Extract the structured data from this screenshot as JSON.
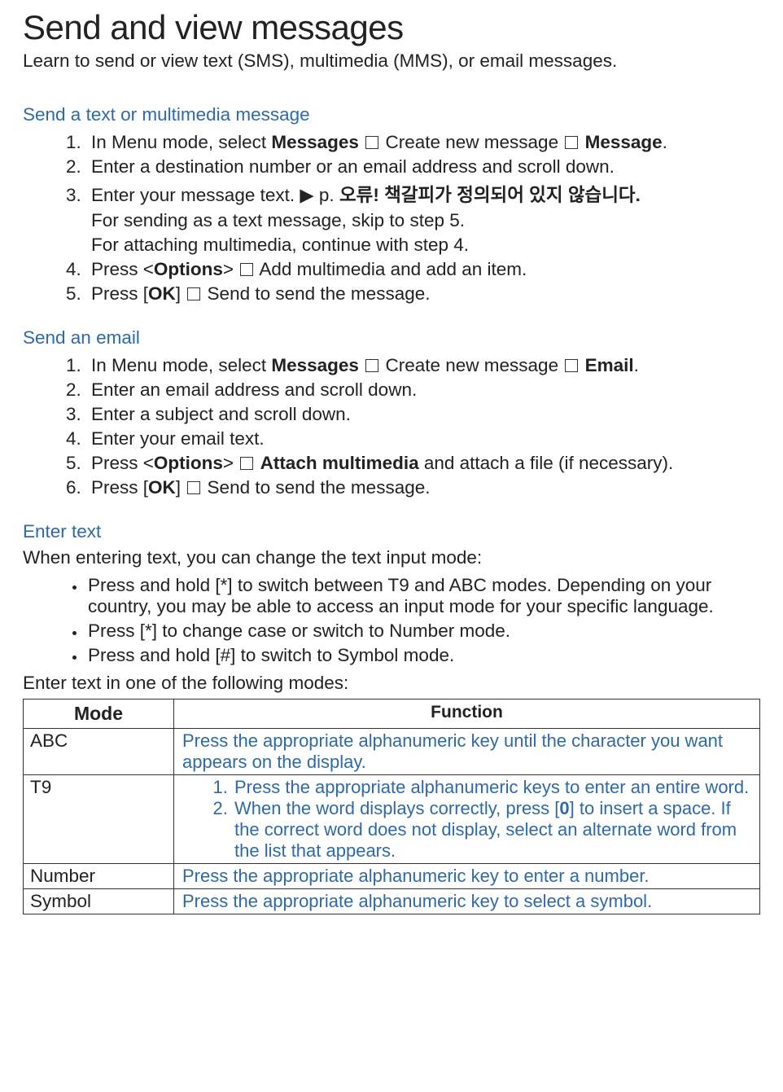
{
  "title": "Send and view messages",
  "subtitle": "Learn to send or view text (SMS), multimedia (MMS), or email messages.",
  "sections": {
    "sms": {
      "heading": "Send a text or multimedia message",
      "step1_a": "In Menu mode, select ",
      "step1_b": "Messages",
      "step1_c": " Create new message ",
      "step1_d": "Message",
      "step1_e": ".",
      "step2": "Enter a destination number or an email address and scroll down.",
      "step3_a": "Enter your message text. ▶ p.  ",
      "step3_b": "오류!  책갈피가  정의되어  있지  않습니다.",
      "step3_sub1": "For sending as a text message, skip to step 5.",
      "step3_sub2": "For attaching multimedia, continue with step 4.",
      "step4_a": "Press <",
      "step4_b": "Options",
      "step4_c": "> ",
      "step4_d": " Add multimedia and add an item.",
      "step5_a": "Press [",
      "step5_b": "OK",
      "step5_c": "] ",
      "step5_d": " Send to send the message."
    },
    "email": {
      "heading": "Send an email",
      "step1_a": "In Menu mode, select ",
      "step1_b": "Messages",
      "step1_c": " Create new message ",
      "step1_d": "Email",
      "step1_e": ".",
      "step2": "Enter an email address and scroll down.",
      "step3": "Enter a subject and scroll down.",
      "step4": "Enter your email text.",
      "step5_a": "Press <",
      "step5_b": "Options",
      "step5_c": "> ",
      "step5_d": "Attach multimedia",
      "step5_e": " and attach a file (if necessary).",
      "step6_a": "Press [",
      "step6_b": "OK",
      "step6_c": "] ",
      "step6_d": " Send to send the message."
    },
    "enter": {
      "heading": "Enter text",
      "intro": "When entering text, you can change the text input mode:",
      "bullet1": "Press and hold [*] to switch between T9 and ABC modes. Depending on your country, you may be able to access an input mode for your specific language.",
      "bullet2": "Press [*] to change case or switch to Number mode.",
      "bullet3": "Press and hold [#] to switch to Symbol mode.",
      "outro": "Enter text in one of the following modes:"
    }
  },
  "table": {
    "head_mode": "Mode",
    "head_func": "Function",
    "rows": {
      "abc": {
        "mode": "ABC",
        "func": "Press the appropriate alphanumeric key until the character you want appears on the display."
      },
      "t9": {
        "mode": "T9",
        "li1": "Press the appropriate alphanumeric keys to enter an entire word.",
        "li2_a": "When the word displays correctly, press [",
        "li2_b": "0",
        "li2_c": "] to insert a space. If the correct word does not display, select an alternate word from the list that appears."
      },
      "number": {
        "mode": "Number",
        "func": "Press the appropriate alphanumeric key to enter a number."
      },
      "symbol": {
        "mode": "Symbol",
        "func": "Press the appropriate alphanumeric key to select a symbol."
      }
    }
  }
}
